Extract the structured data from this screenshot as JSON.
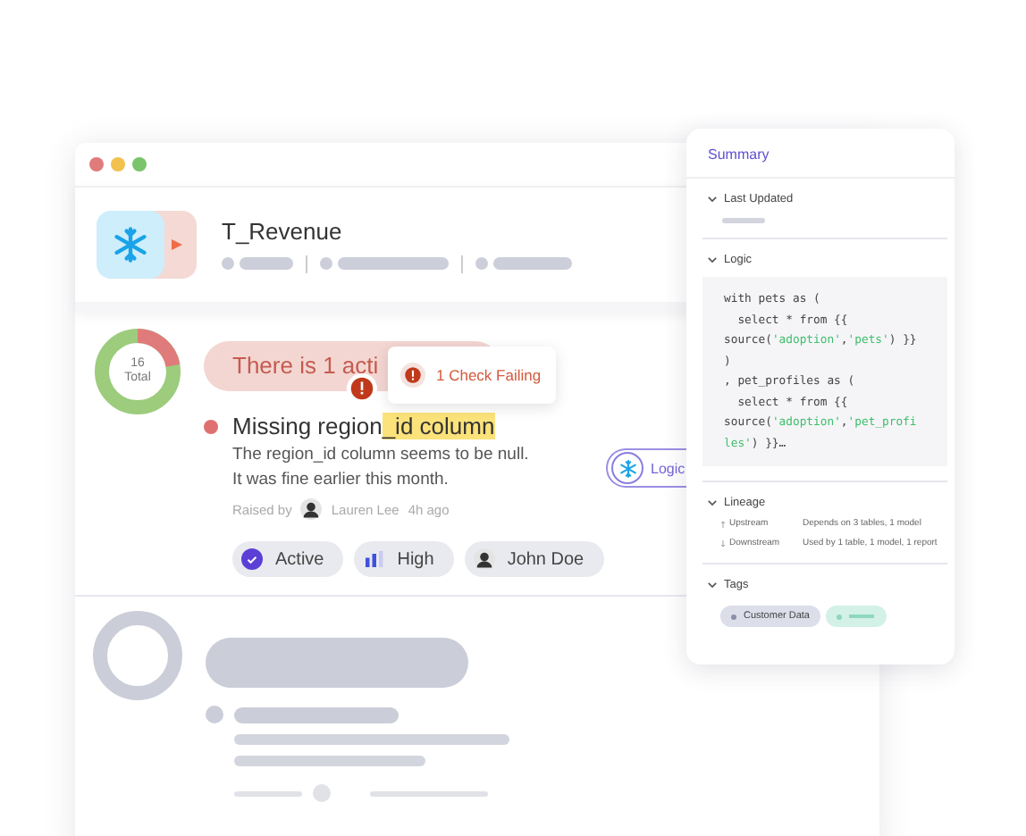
{
  "window": {
    "controls": [
      {
        "color": "#e07b7b"
      },
      {
        "color": "#f2c14e"
      },
      {
        "color": "#7ac46b"
      }
    ]
  },
  "table_header": {
    "title": "T_Revenue"
  },
  "issue_summary": {
    "total": "16",
    "total_label": "Total",
    "banner": "There is 1 acti",
    "tooltip": "1 Check Failing"
  },
  "issue": {
    "title": "Missing region",
    "title_highlight": "_id column",
    "description": [
      "The region_id column seems to be null.",
      "It was fine earlier this month."
    ],
    "raised_by_label": "Raised by",
    "raised_by": "Lauren Lee",
    "time": "4h ago",
    "chips": [
      {
        "kind": "status",
        "label": "Active"
      },
      {
        "kind": "priority",
        "label": "High"
      },
      {
        "kind": "assignee",
        "label": "John Doe"
      }
    ]
  },
  "logic_chip": {
    "label": "Logic"
  },
  "summary": {
    "title": "Summary",
    "sections": [
      {
        "kind": "skeleton",
        "title": "Last Updated",
        "expanded": true
      },
      {
        "kind": "code",
        "title": "Logic",
        "expanded": true,
        "code": [
          [
            {
              "kind": "plain",
              "text": "with pets as ("
            }
          ],
          [
            {
              "kind": "plain",
              "text": "  select * from {{"
            }
          ],
          [
            {
              "kind": "plain",
              "text": "source("
            },
            {
              "kind": "string",
              "text": "'adoption'"
            },
            {
              "kind": "plain",
              "text": ","
            },
            {
              "kind": "string",
              "text": "'pets'"
            },
            {
              "kind": "plain",
              "text": ") }}"
            }
          ],
          [
            {
              "kind": "plain",
              "text": ")"
            }
          ],
          [
            {
              "kind": "plain",
              "text": ", pet_profiles as ("
            }
          ],
          [
            {
              "kind": "plain",
              "text": "  select * from {{"
            }
          ],
          [
            {
              "kind": "plain",
              "text": "source("
            },
            {
              "kind": "string",
              "text": "'adoption'"
            },
            {
              "kind": "plain",
              "text": ","
            },
            {
              "kind": "string",
              "text": "'pet_profi"
            }
          ],
          [
            {
              "kind": "string",
              "text": "les'"
            },
            {
              "kind": "plain",
              "text": ") }}…"
            }
          ]
        ]
      },
      {
        "kind": "lineage",
        "title": "Lineage",
        "expanded": true,
        "rows": [
          {
            "kind": "upstream",
            "label": "Upstream",
            "value": "Depends on 3 tables, 1 model"
          },
          {
            "kind": "downstream",
            "label": "Downstream",
            "value": "Used by 1 table, 1 model, 1 report"
          }
        ]
      },
      {
        "kind": "tags",
        "title": "Tags",
        "expanded": true,
        "tags": [
          {
            "label": "Customer Data"
          }
        ]
      }
    ]
  }
}
